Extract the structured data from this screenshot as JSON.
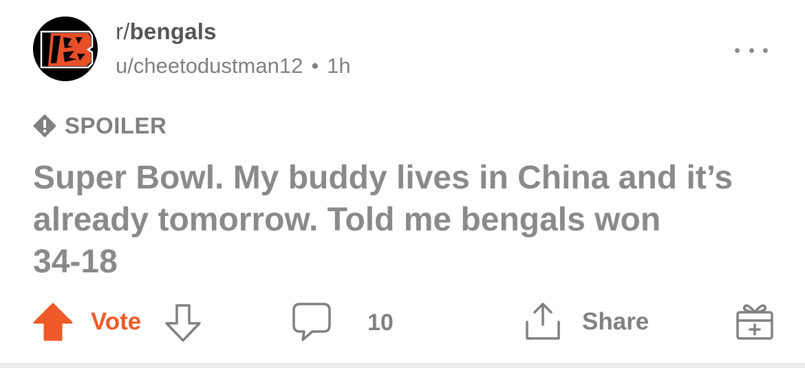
{
  "post": {
    "subreddit_prefix": "r/",
    "subreddit_name": "bengals",
    "author": "u/cheetodustman12",
    "separator": "•",
    "age": "1h",
    "tag": "SPOILER",
    "title_lines": [
      "Super Bowl. My buddy lives in China and it’s",
      "already tomorrow. Told me bengals won",
      "34-18"
    ]
  },
  "actions": {
    "vote_label": "Vote",
    "comment_count": "10",
    "share_label": "Share"
  },
  "icons": {
    "avatar": "bengals-logo-icon",
    "more": "more-options-icon",
    "spoiler": "spoiler-warning-icon",
    "upvote": "upvote-arrow-icon",
    "downvote": "downvote-arrow-icon",
    "comment": "comment-bubble-icon",
    "share": "share-icon",
    "award": "gift-award-icon"
  },
  "colors": {
    "accent": "#ee5a28",
    "text_muted": "#808080",
    "title": "#8a8a8a",
    "logo_orange": "#e8502a"
  }
}
